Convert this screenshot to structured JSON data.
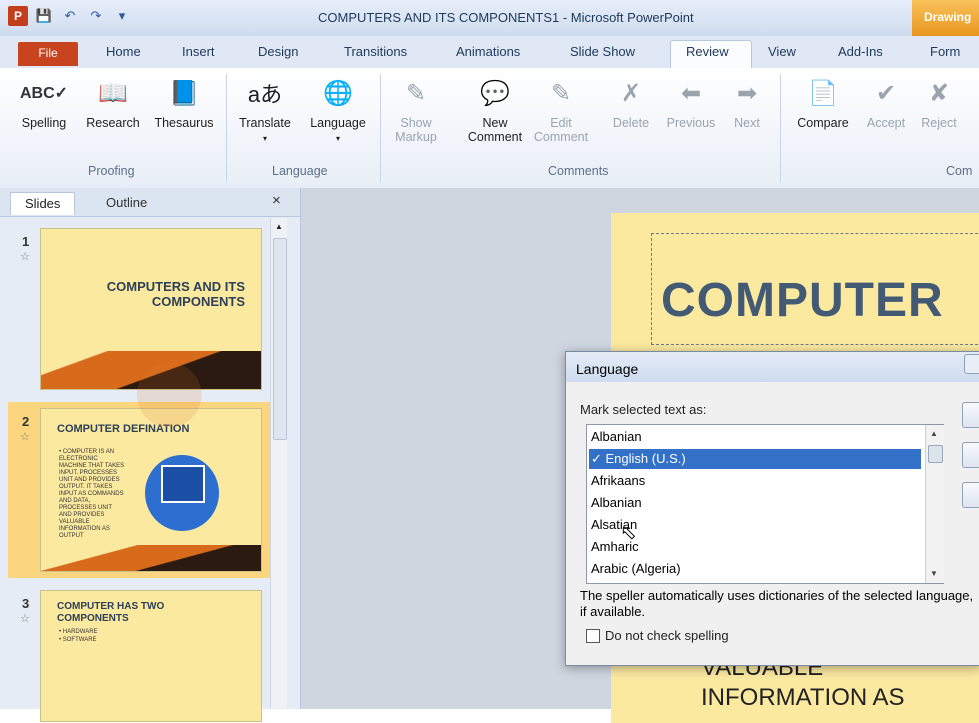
{
  "window": {
    "title": "COMPUTERS AND ITS COMPONENTS1 - Microsoft PowerPoint",
    "context_tab": "Drawing"
  },
  "qat": {
    "app_icon": "P"
  },
  "tabs": {
    "file": "File",
    "home": "Home",
    "insert": "Insert",
    "design": "Design",
    "transitions": "Transitions",
    "animations": "Animations",
    "slideshow": "Slide Show",
    "review": "Review",
    "view": "View",
    "addins": "Add-Ins",
    "format": "Form"
  },
  "ribbon": {
    "spelling": "Spelling",
    "research": "Research",
    "thesaurus": "Thesaurus",
    "translate": "Translate",
    "language": "Language",
    "show_markup_1": "Show",
    "show_markup_2": "Markup",
    "new_comment_1": "New",
    "new_comment_2": "Comment",
    "edit_comment_1": "Edit",
    "edit_comment_2": "Comment",
    "delete": "Delete",
    "previous": "Previous",
    "next": "Next",
    "compare": "Compare",
    "accept": "Accept",
    "reject": "Reject",
    "groups": {
      "proofing": "Proofing",
      "language": "Language",
      "comments": "Comments",
      "compare": "Com"
    }
  },
  "slides_pane": {
    "tab_slides": "Slides",
    "tab_outline": "Outline",
    "close": "×",
    "slides": [
      {
        "num": "1",
        "title": "COMPUTERS AND ITS COMPONENTS"
      },
      {
        "num": "2",
        "title": "COMPUTER DEFINATION",
        "body": "• COMPUTER IS AN ELECTRONIC MACHINE THAT TAKES INPUT, PROCESSES UNIT AND PROVIDES OUTPUT. IT TAKES INPUT AS COMMANDS AND DATA, PROCESSES UNIT AND PROVIDES VALUABLE INFORMATION AS OUTPUT"
      },
      {
        "num": "3",
        "title": "COMPUTER HAS TWO COMPONENTS",
        "body_1": "• HARDWARE",
        "body_2": "• SOFTWARE"
      }
    ]
  },
  "slide": {
    "title": "COMPUTER",
    "body_1": "VALUABLE",
    "body_2": "INFORMATION AS"
  },
  "language_dialog": {
    "title": "Language",
    "mark_label": "Mark selected text as:",
    "items": [
      "Albanian",
      "English (U.S.)",
      "Afrikaans",
      "Albanian",
      "Alsatian",
      "Amharic",
      "Arabic (Algeria)"
    ],
    "selected": "English (U.S.)",
    "note": "The speller automatically uses dictionaries of the selected language, if available.",
    "no_check": "Do not check spelling"
  },
  "colors": {
    "accent": "#c8441f",
    "selection": "#3370c8",
    "slide_bg": "#fbe9a0"
  }
}
